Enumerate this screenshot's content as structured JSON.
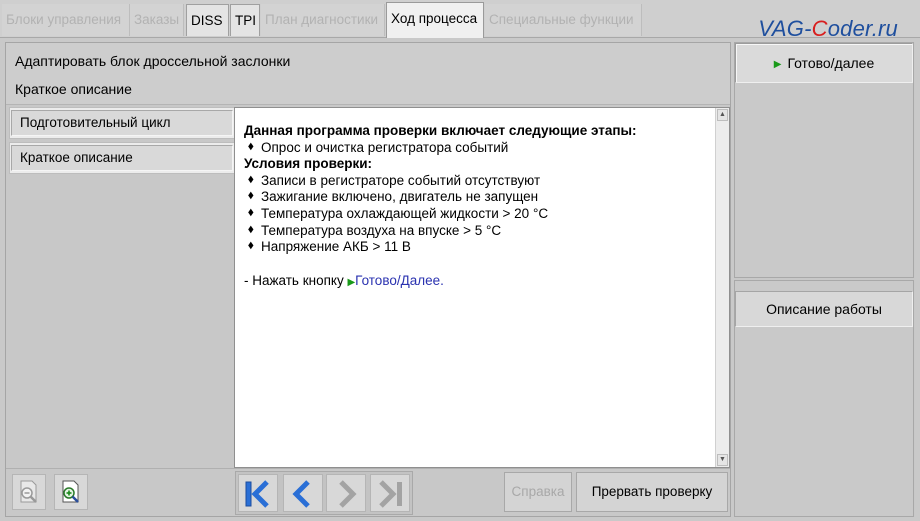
{
  "tabs": [
    {
      "label": "Блоки управления",
      "state": "disabled"
    },
    {
      "label": "Заказы",
      "state": "disabled"
    },
    {
      "label": "DISS",
      "state": "enabled"
    },
    {
      "label": "TPI",
      "state": "enabled"
    },
    {
      "label": "План диагностики",
      "state": "disabled"
    },
    {
      "label": "Ход процесса",
      "state": "active"
    },
    {
      "label": "Специальные функции",
      "state": "disabled"
    }
  ],
  "watermark": {
    "pre": "VAG-",
    "highlight": "C",
    "post": "oder.ru"
  },
  "header": {
    "title": "Адаптировать блок дроссельной заслонки",
    "subtitle": "Краткое описание"
  },
  "nav": {
    "items": [
      "Подготовительный цикл",
      "Краткое описание"
    ]
  },
  "content": {
    "heading1": "Данная программа проверки включает следующие этапы:",
    "stages": [
      "Опрос и очистка регистратора событий"
    ],
    "heading2": "Условия проверки:",
    "conditions": [
      "Записи в регистраторе событий отсутствуют",
      "Зажигание включено, двигатель не запущен",
      "Температура охлаждающей жидкости > 20 °C",
      "Температура воздуха на впуске > 5 °C",
      "Напряжение АКБ > 11 В"
    ],
    "press_prefix": "- Нажать кнопку ",
    "press_link": "Готово/Далее."
  },
  "toolbar": {
    "zoom_out_icon": "zoom-out-icon",
    "zoom_in_icon": "zoom-in-icon",
    "first_icon": "skip-first-icon",
    "prev_icon": "chevron-left-icon",
    "next_icon": "chevron-right-icon",
    "last_icon": "skip-last-icon",
    "help_label": "Справка",
    "abort_label": "Прервать проверку"
  },
  "right": {
    "ready_label": "Готово/далее",
    "description_label": "Описание работы"
  },
  "colors": {
    "accent_blue": "#2a6fd6",
    "arrow_green": "#1a9a1a",
    "link_blue": "#2a32b0",
    "watermark_red": "#d81e1e"
  }
}
